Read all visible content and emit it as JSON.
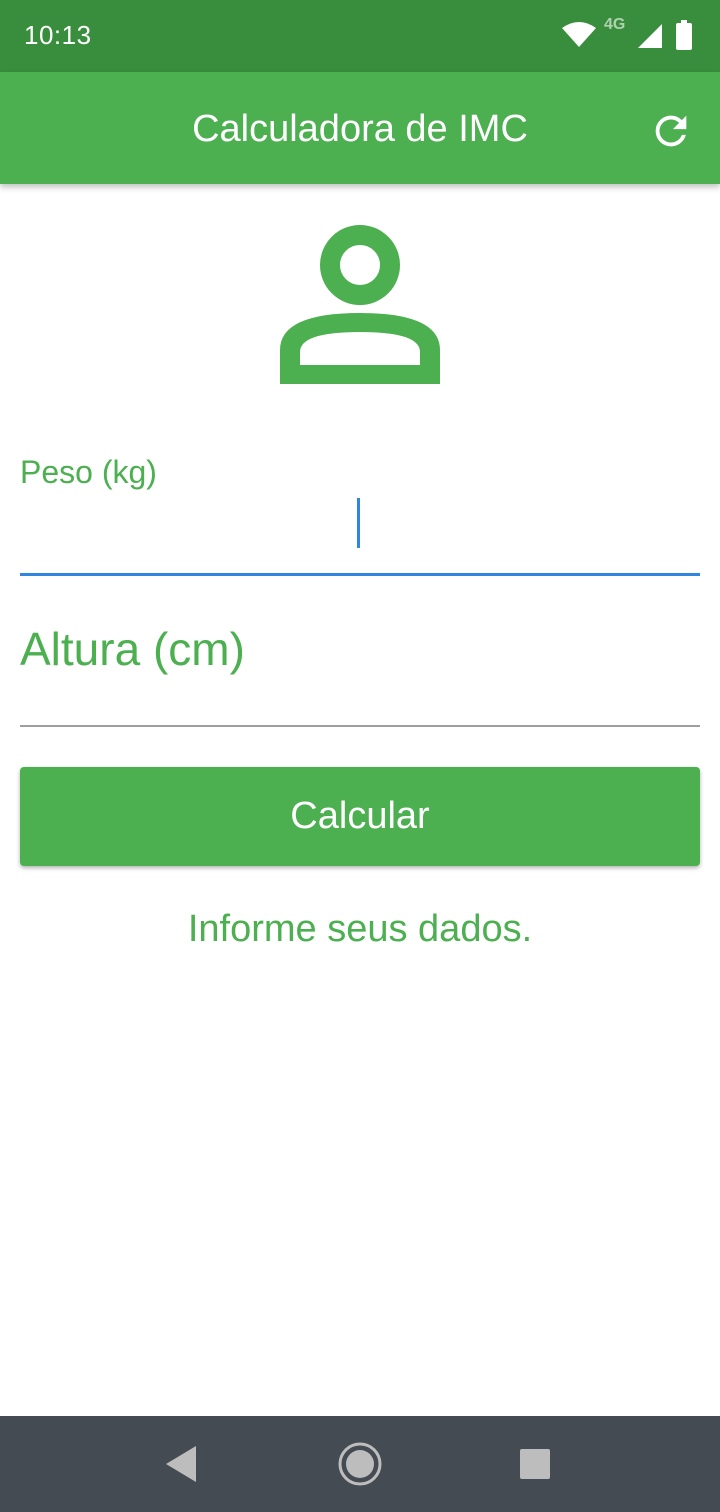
{
  "status_bar": {
    "time": "10:13",
    "network_label": "4G",
    "icons": [
      "wifi-icon",
      "signal-icon",
      "battery-icon"
    ]
  },
  "app_bar": {
    "title": "Calculadora de IMC",
    "refresh_icon": "refresh-icon"
  },
  "header_icon": "person-icon",
  "form": {
    "weight": {
      "label": "Peso (kg)",
      "value": "",
      "focused": true
    },
    "height": {
      "label": "Altura (cm)",
      "value": "",
      "focused": false
    },
    "submit_label": "Calcular"
  },
  "info_text": "Informe seus dados.",
  "nav_bar": {
    "icons": [
      "back-icon",
      "home-icon",
      "recents-icon"
    ]
  },
  "colors": {
    "primary": "#4CAF50",
    "primary_dark": "#388E3C",
    "focus_accent": "#2E86DE",
    "nav_background": "#454B52"
  }
}
